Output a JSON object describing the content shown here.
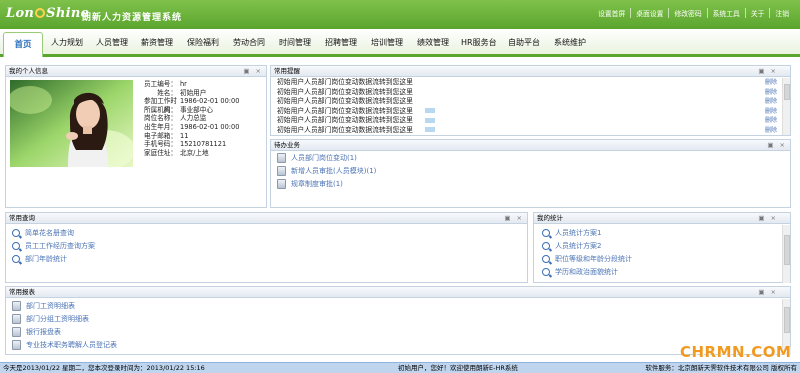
{
  "header": {
    "logo_pre": "Lon",
    "logo_post": "Shine",
    "app_name": "朗新人力资源管理系统",
    "links": [
      "设置首屏",
      "桌面设置",
      "修改密码",
      "系统工具",
      "关于",
      "注销"
    ]
  },
  "nav": {
    "items": [
      "首页",
      "人力规划",
      "人员管理",
      "薪资管理",
      "保险福利",
      "劳动合同",
      "时间管理",
      "招聘管理",
      "培训管理",
      "绩效管理",
      "HR服务台",
      "自助平台",
      "系统维护"
    ]
  },
  "profile": {
    "title": "我的个人信息",
    "fields": [
      {
        "label": "员工编号：",
        "value": "hr"
      },
      {
        "label": "姓名：",
        "value": "初始用户"
      },
      {
        "label": "参加工作时间：",
        "value": "1986-02-01 00:00"
      },
      {
        "label": "所属机构：",
        "value": "事业部中心"
      },
      {
        "label": "岗位名称：",
        "value": "人力总监"
      },
      {
        "label": "出生年月：",
        "value": "1986-02-01 00:00"
      },
      {
        "label": "电子邮箱：",
        "value": "11"
      },
      {
        "label": "手机号码：",
        "value": "15210781121"
      },
      {
        "label": "家庭住址：",
        "value": "北京/上地"
      }
    ]
  },
  "reminders": {
    "title": "常用提醒",
    "delete_label": "删除",
    "items": [
      "初始用户人员部门岗位变动数据流转到您这里",
      "初始用户人员部门岗位变动数据流转到您这里",
      "初始用户人员部门岗位变动数据流转到您这里",
      "初始用户人员部门岗位变动数据流转到您这里",
      "初始用户人员部门岗位变动数据流转到您这里",
      "初始用户人员部门岗位变动数据流转到您这里"
    ]
  },
  "todo": {
    "title": "待办业务",
    "items": [
      "人员部门岗位变动(1)",
      "新增人员审批(人员模块)(1)",
      "规章制度审批(1)"
    ]
  },
  "queries": {
    "title": "常用查询",
    "items": [
      "简单花名册查询",
      "员工工作经历查询方案",
      "部门年龄统计"
    ]
  },
  "stats": {
    "title": "我的统计",
    "items": [
      "人员统计方案1",
      "人员统计方案2",
      "职位等级和年龄分段统计",
      "学历和政治面貌统计"
    ]
  },
  "reports": {
    "title": "常用报表",
    "items": [
      "部门工资明细表",
      "部门分组工资明细表",
      "银行报盘表",
      "专业技术职务聘解人员登记表"
    ]
  },
  "status": {
    "left": "今天是2013/01/22 星期二，您本次登录时间为：2013/01/22 15:16",
    "center": "初始用户，您好！欢迎使用朗新E-HR系统",
    "right": "软件服务：北京朗新天霁软件技术有限公司 版权所有"
  },
  "watermark": "CHRMN.COM",
  "colors": {
    "header": "#6db63e",
    "link": "#4a73b5",
    "status_bar": "#bfd5ee"
  }
}
